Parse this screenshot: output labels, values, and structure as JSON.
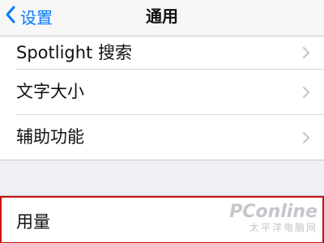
{
  "navbar": {
    "back_label": "设置",
    "title": "通用"
  },
  "settings": {
    "group1": [
      {
        "label": "Spotlight 搜索"
      },
      {
        "label": "文字大小"
      },
      {
        "label": "辅助功能"
      }
    ],
    "group2": [
      {
        "label": "用量",
        "highlighted": true
      }
    ]
  },
  "watermark": {
    "logo": "PConline",
    "subtitle": "太平洋电脑网"
  },
  "colors": {
    "accent": "#007aff",
    "highlight_border": "#c81414",
    "background": "#efeff4",
    "chevron": "#c7c7cc"
  }
}
